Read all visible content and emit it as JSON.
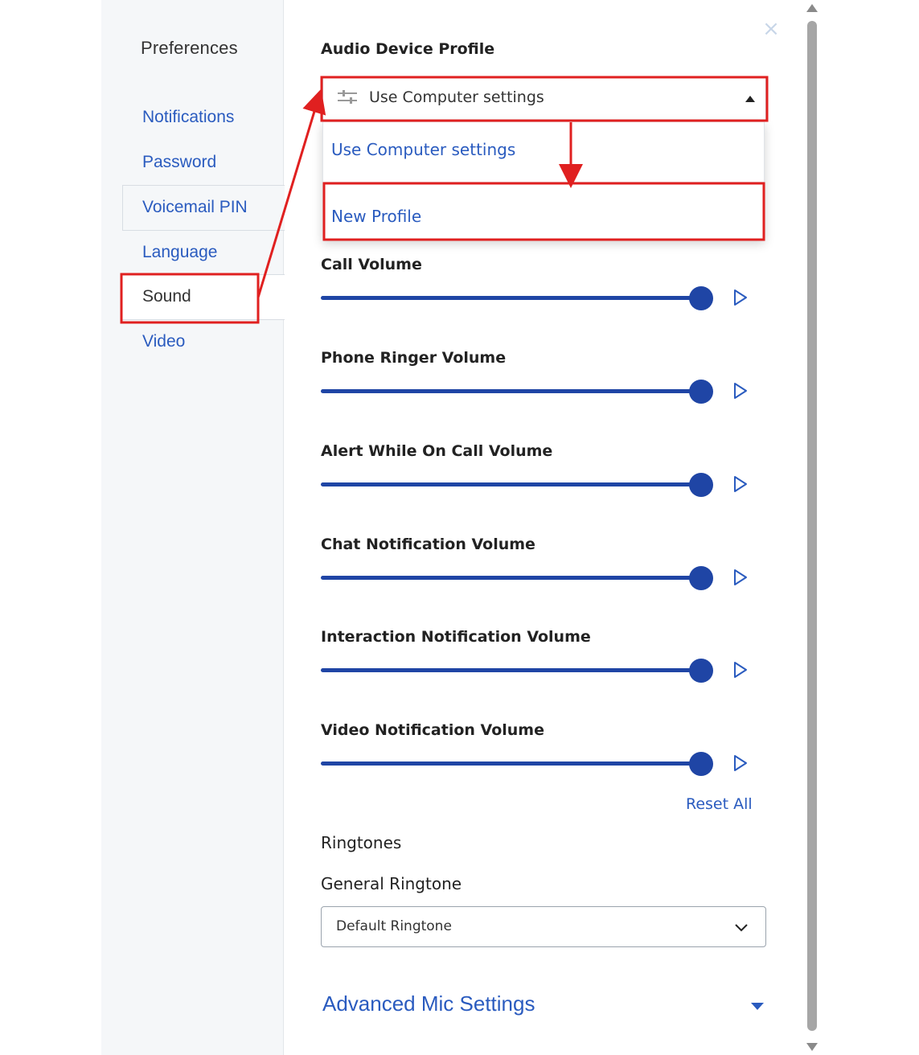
{
  "sidebar": {
    "title": "Preferences",
    "items": [
      {
        "label": "Notifications"
      },
      {
        "label": "Password"
      },
      {
        "label": "Voicemail PIN"
      },
      {
        "label": "Language"
      },
      {
        "label": "Sound",
        "selected": true
      },
      {
        "label": "Video"
      }
    ]
  },
  "audio_profile": {
    "heading": "Audio Device Profile",
    "selected": "Use Computer settings",
    "options": [
      "Use Computer settings",
      "New Profile"
    ]
  },
  "volumes": [
    {
      "label": "Call Volume",
      "level": 1.0
    },
    {
      "label": "Phone Ringer Volume",
      "level": 1.0
    },
    {
      "label": "Alert While On Call Volume",
      "level": 1.0
    },
    {
      "label": "Chat Notification Volume",
      "level": 1.0
    },
    {
      "label": "Interaction Notification Volume",
      "level": 1.0
    },
    {
      "label": "Video Notification Volume",
      "level": 1.0
    }
  ],
  "reset_all_label": "Reset All",
  "ringtones": {
    "heading": "Ringtones",
    "general_label": "General Ringtone",
    "general_value": "Default Ringtone"
  },
  "advanced": {
    "label": "Advanced Mic Settings"
  },
  "colors": {
    "accent": "#1f45a5",
    "link": "#2a5bbf",
    "annotation": "#e02020"
  },
  "icons": {
    "close": "close-icon",
    "profile": "tune-icon",
    "play": "play-icon",
    "chevron": "chevron-down-icon"
  }
}
